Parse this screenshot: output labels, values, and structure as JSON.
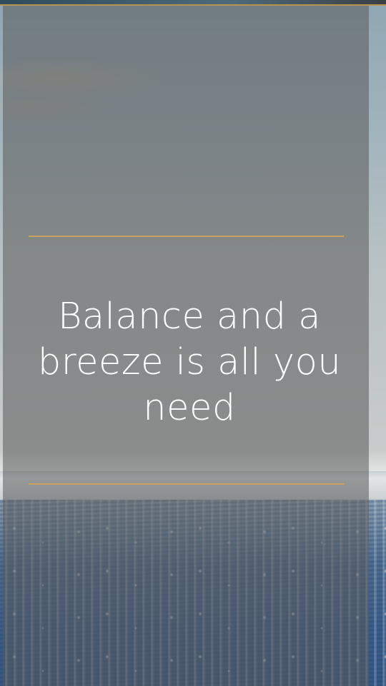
{
  "quote": {
    "text": "Balance and a breeze is all you need"
  },
  "colors": {
    "accent_rule": "#c9a262",
    "overlay": "#5a5a5a",
    "text": "#ffffff"
  }
}
